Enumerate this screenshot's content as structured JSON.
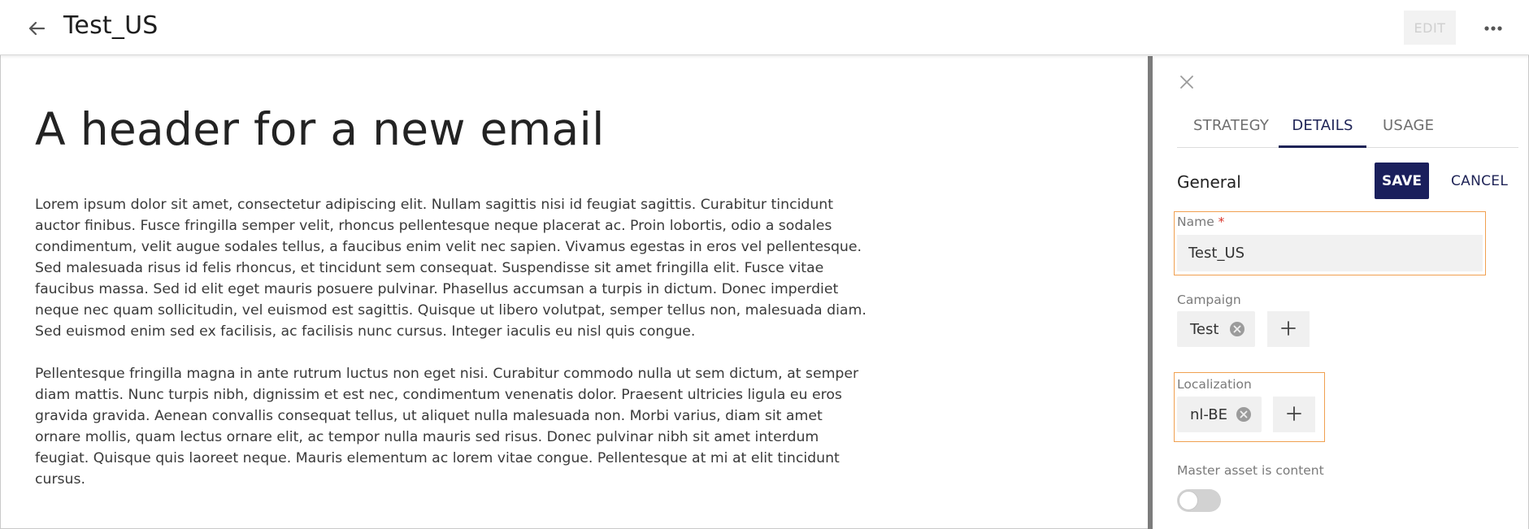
{
  "header": {
    "title": "Test_US",
    "edit_label": "EDIT"
  },
  "email": {
    "heading": "A header for a new email",
    "paragraphs": [
      "Lorem ipsum dolor sit amet, consectetur adipiscing elit. Nullam sagittis nisi id feugiat sagittis. Curabitur tincidunt auctor finibus. Fusce fringilla semper velit, rhoncus pellentesque neque placerat ac. Proin lobortis, odio a sodales condimentum, velit augue sodales tellus, a faucibus enim velit nec sapien. Vivamus egestas in eros vel pellentesque. Sed malesuada risus id felis rhoncus, et tincidunt sem consequat. Suspendisse sit amet fringilla elit. Fusce vitae faucibus massa. Sed id elit eget mauris posuere pulvinar. Phasellus accumsan a turpis in dictum. Donec imperdiet neque nec quam sollicitudin, vel euismod est sagittis. Quisque ut libero volutpat, semper tellus non, malesuada diam. Sed euismod enim sed ex facilisis, ac facilisis nunc cursus. Integer iaculis eu nisl quis congue.",
      "Pellentesque fringilla magna in ante rutrum luctus non eget nisi. Curabitur commodo nulla ut sem dictum, at semper diam mattis. Nunc turpis nibh, dignissim et est nec, condimentum venenatis dolor. Praesent ultricies ligula eu eros gravida gravida. Aenean convallis consequat tellus, ut aliquet nulla malesuada non. Morbi varius, diam sit amet ornare mollis, quam lectus ornare elit, ac tempor nulla mauris sed risus. Donec pulvinar nibh sit amet interdum feugiat. Quisque quis laoreet neque. Mauris elementum ac lorem vitae congue. Pellentesque at mi at elit tincidunt cursus."
    ]
  },
  "panel": {
    "tabs": [
      {
        "label": "STRATEGY"
      },
      {
        "label": "DETAILS"
      },
      {
        "label": "USAGE"
      }
    ],
    "section_title": "General",
    "save_label": "SAVE",
    "cancel_label": "CANCEL",
    "name": {
      "label": "Name",
      "required_mark": "*",
      "value": "Test_US"
    },
    "campaign": {
      "label": "Campaign",
      "chips": [
        "Test"
      ]
    },
    "localization": {
      "label": "Localization",
      "chips": [
        "nl-BE"
      ]
    },
    "master_asset": {
      "label": "Master asset is content",
      "enabled": false
    }
  },
  "colors": {
    "accent": "#1a1f5c",
    "highlight_border": "#f0a050",
    "required": "#d9352b"
  },
  "icons": [
    "arrow-back-icon",
    "more-horizontal-icon",
    "close-icon",
    "remove-circle-icon",
    "plus-icon"
  ]
}
